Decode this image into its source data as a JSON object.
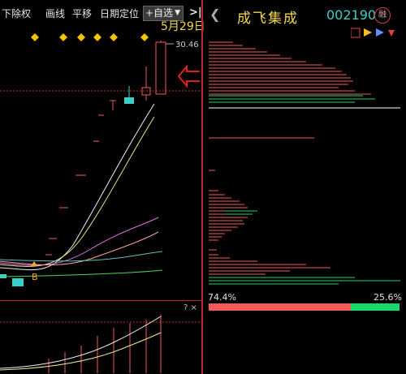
{
  "toolbar": {
    "items": [
      "下除权",
      "画线",
      "平移",
      "日期定位"
    ],
    "select_label": "+自选",
    "expand_label": ">|"
  },
  "chart": {
    "date_label": "5月29日",
    "top_price": "30.46",
    "marker_b": "B"
  },
  "panel": {
    "title": "成飞集成",
    "code": "002190",
    "rong_badge": "融",
    "percent_profit": "74.4%",
    "percent_loss": "25.6%",
    "profit_ratio": 0.744,
    "colors": {
      "red": "#f25a5a",
      "green": "#18d86b",
      "yellow": "#f5d84a",
      "cyan": "#39d0c9"
    }
  },
  "sub_chart": {
    "icons": "? ×"
  }
}
